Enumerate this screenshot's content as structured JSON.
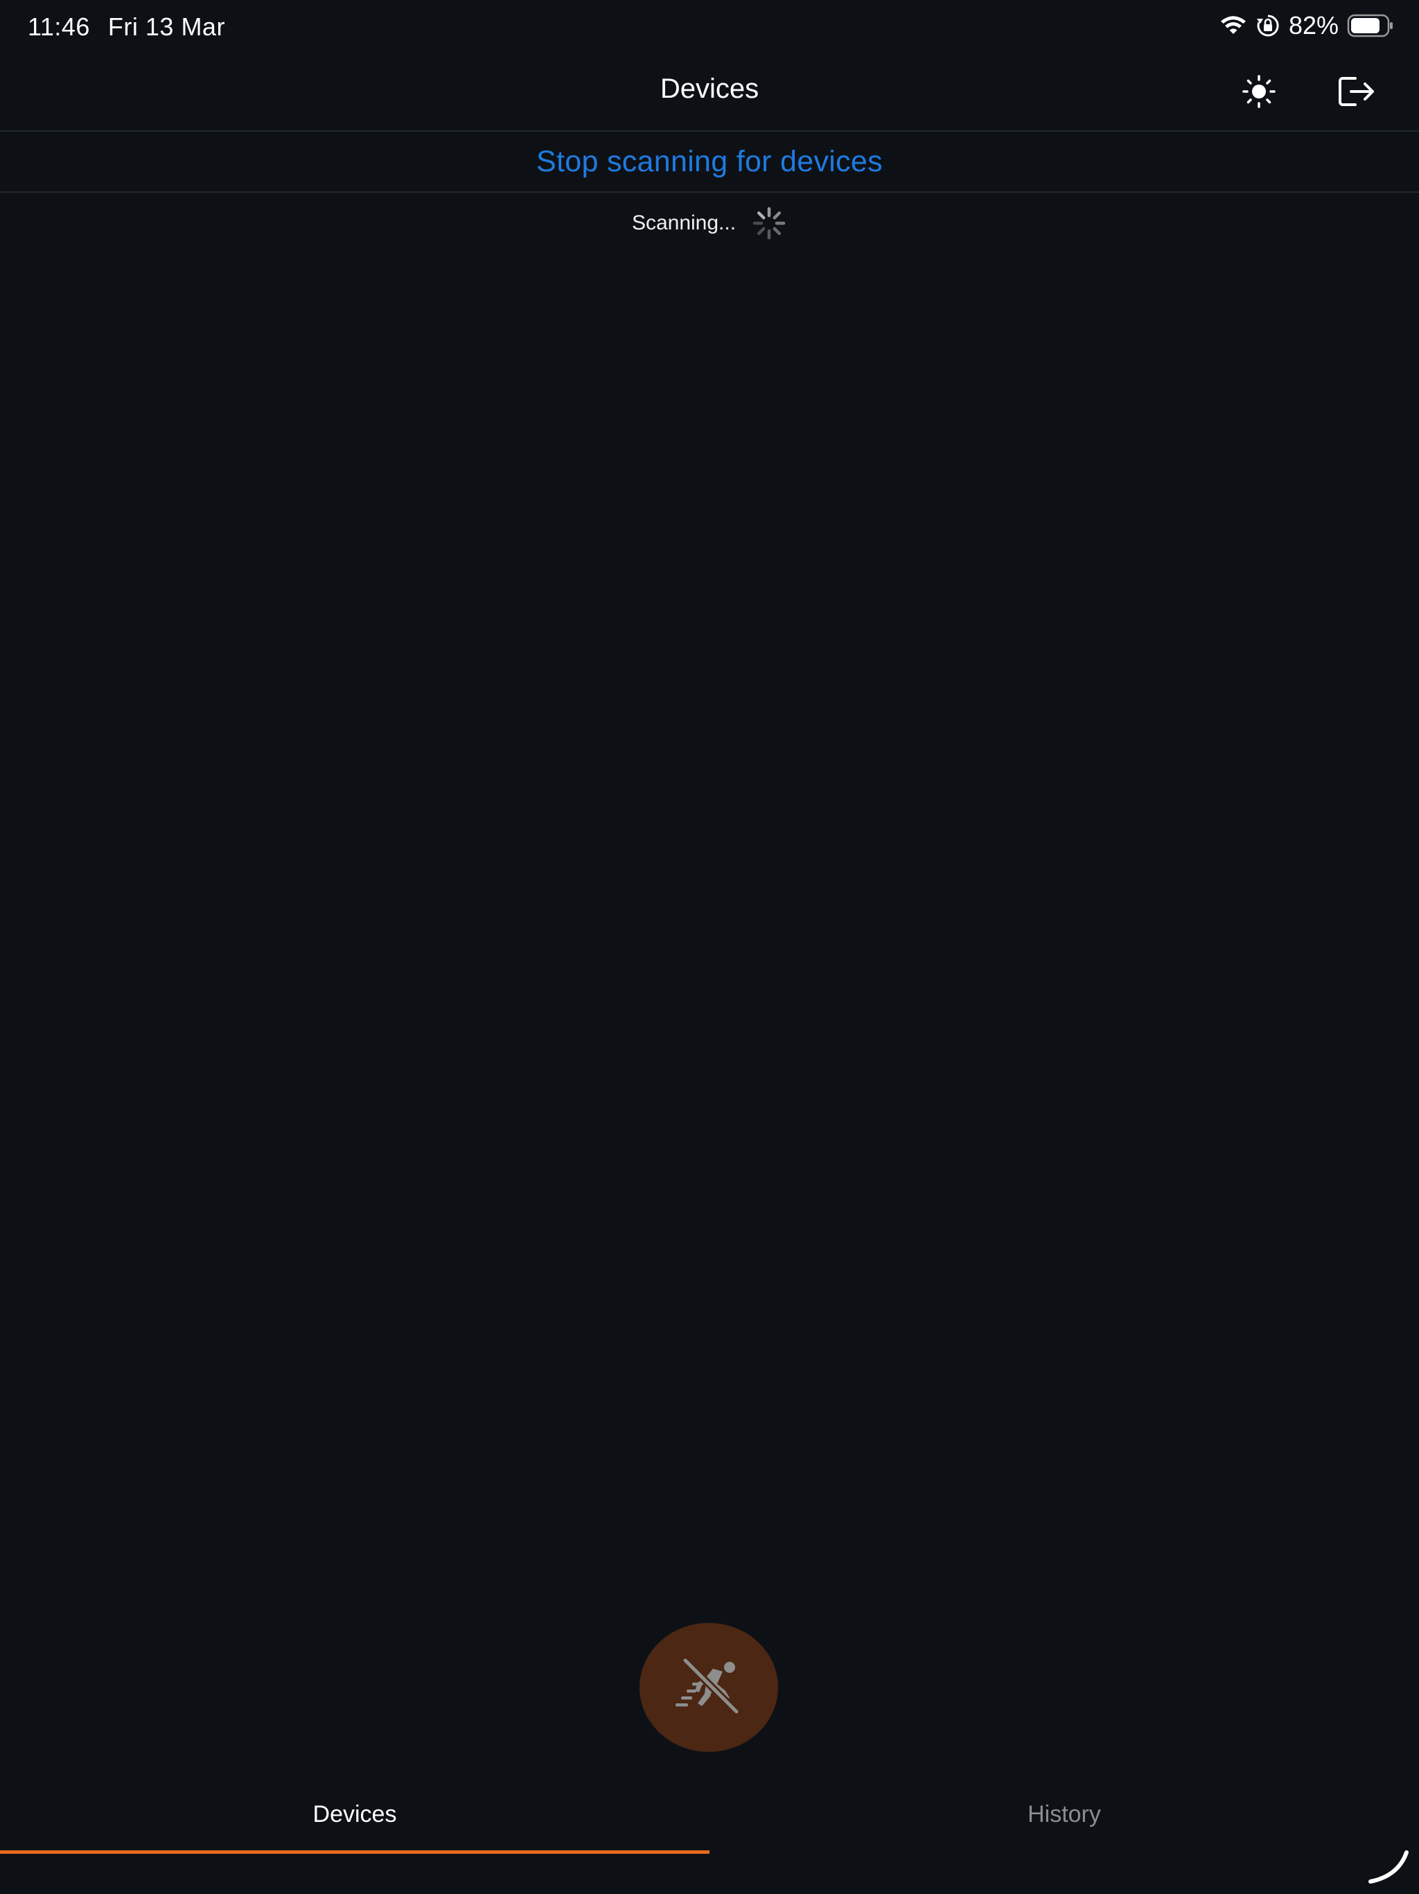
{
  "status_bar": {
    "time": "11:46",
    "date": "Fri 13 Mar",
    "battery": "82%",
    "battery_level": 0.82
  },
  "header": {
    "title": "Devices",
    "theme_icon": "sun-icon",
    "logout_icon": "logout-icon"
  },
  "scan": {
    "stop_label": "Stop scanning for devices",
    "status_text": "Scanning..."
  },
  "fab": {
    "icon": "no-running-icon"
  },
  "tabs": [
    {
      "label": "Devices",
      "active": true
    },
    {
      "label": "History",
      "active": false
    }
  ],
  "colors": {
    "background": "#0d1116",
    "link_blue": "#1f7ae0",
    "accent_orange": "#e86a1e",
    "fab_background": "#4c2713",
    "inactive_tab": "#8a8d92"
  }
}
